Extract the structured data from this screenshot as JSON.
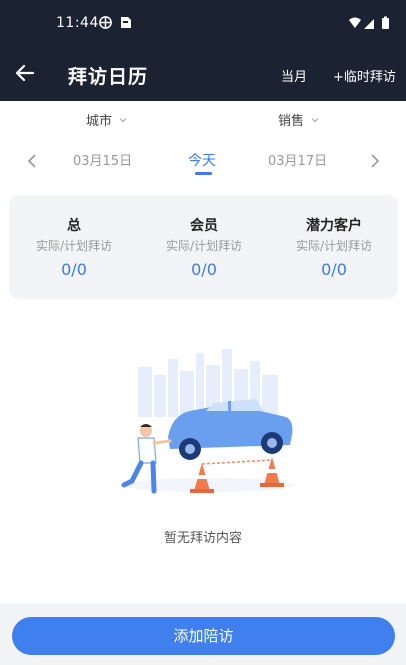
{
  "status_bar": {
    "time": "11:44"
  },
  "app_bar": {
    "title": "拜访日历",
    "month_label": "当月",
    "temp_visit_label": "+临时拜访"
  },
  "filters": {
    "city": "城市",
    "sales": "销售"
  },
  "dates": {
    "prev": "03月15日",
    "today": "今天",
    "next": "03月17日"
  },
  "stats": [
    {
      "title": "总",
      "subtitle": "实际/计划拜访",
      "value": "0/0"
    },
    {
      "title": "会员",
      "subtitle": "实际/计划拜访",
      "value": "0/0"
    },
    {
      "title": "潜力客户",
      "subtitle": "实际/计划拜访",
      "value": "0/0"
    }
  ],
  "empty_state": {
    "text": "暂无拜访内容"
  },
  "bottom": {
    "add_button": "添加陪访"
  },
  "colors": {
    "accent": "#3f7ae6",
    "header": "#1b2333",
    "button": "#3f80ee"
  }
}
